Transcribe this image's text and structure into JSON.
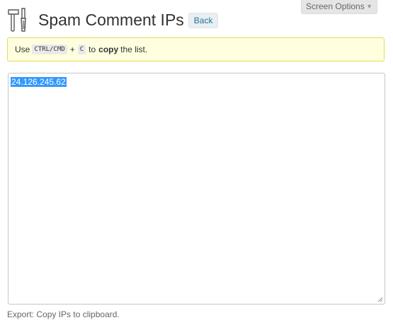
{
  "screen_options": {
    "label": "Screen Options",
    "arrow": "▼"
  },
  "header": {
    "icon": "tools-icon",
    "title": "Spam Comment IPs",
    "back_label": "Back"
  },
  "notice": {
    "prefix": "Use",
    "key1": "CTRL/CMD",
    "plus": "+",
    "key2": "C",
    "mid": "to",
    "bold": "copy",
    "suffix": "the list."
  },
  "textarea": {
    "value": "24.126.245.62"
  },
  "footer": {
    "export_note": "Export: Copy IPs to clipboard."
  }
}
